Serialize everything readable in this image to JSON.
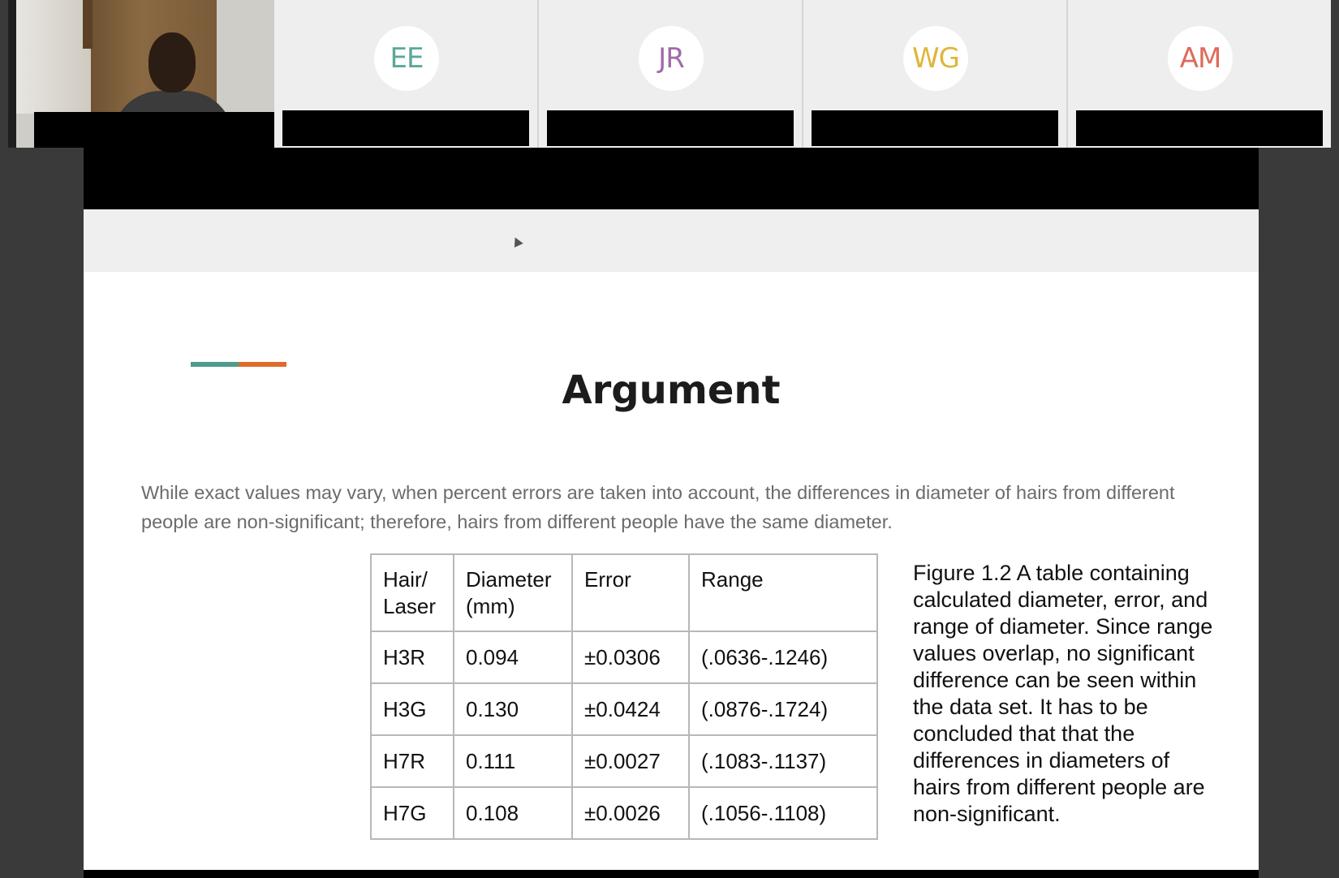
{
  "participants": [
    {
      "initials": "EE",
      "color": "#5aa89a"
    },
    {
      "initials": "JR",
      "color": "#a06aaa"
    },
    {
      "initials": "WG",
      "color": "#e0b53a"
    },
    {
      "initials": "AM",
      "color": "#de6b5a"
    }
  ],
  "slide": {
    "title": "Argument",
    "body": "While exact values may vary, when percent errors are taken into account, the differences in diameter of hairs from different people are non-significant; therefore, hairs from different people have the same diameter.",
    "table": {
      "headers": [
        "Hair/ Laser",
        "Diameter (mm)",
        "Error",
        "Range"
      ],
      "rows": [
        [
          "H3R",
          "0.094",
          "±0.0306",
          "(.0636-.1246)"
        ],
        [
          "H3G",
          "0.130",
          "±0.0424",
          "(.0876-.1724)"
        ],
        [
          "H7R",
          "0.111",
          "±0.0027",
          "(.1083-.1137)"
        ],
        [
          "H7G",
          "0.108",
          "±0.0026",
          "(.1056-.1108)"
        ]
      ]
    },
    "caption": "Figure 1.2 A table containing calculated diameter, error, and range of diameter. Since range values overlap, no significant difference can be seen within the data set. It has to be concluded that that the differences in diameters of hairs from different people are non-significant.",
    "accent_colors": [
      "#4e9b8f",
      "#de6b2a"
    ]
  }
}
